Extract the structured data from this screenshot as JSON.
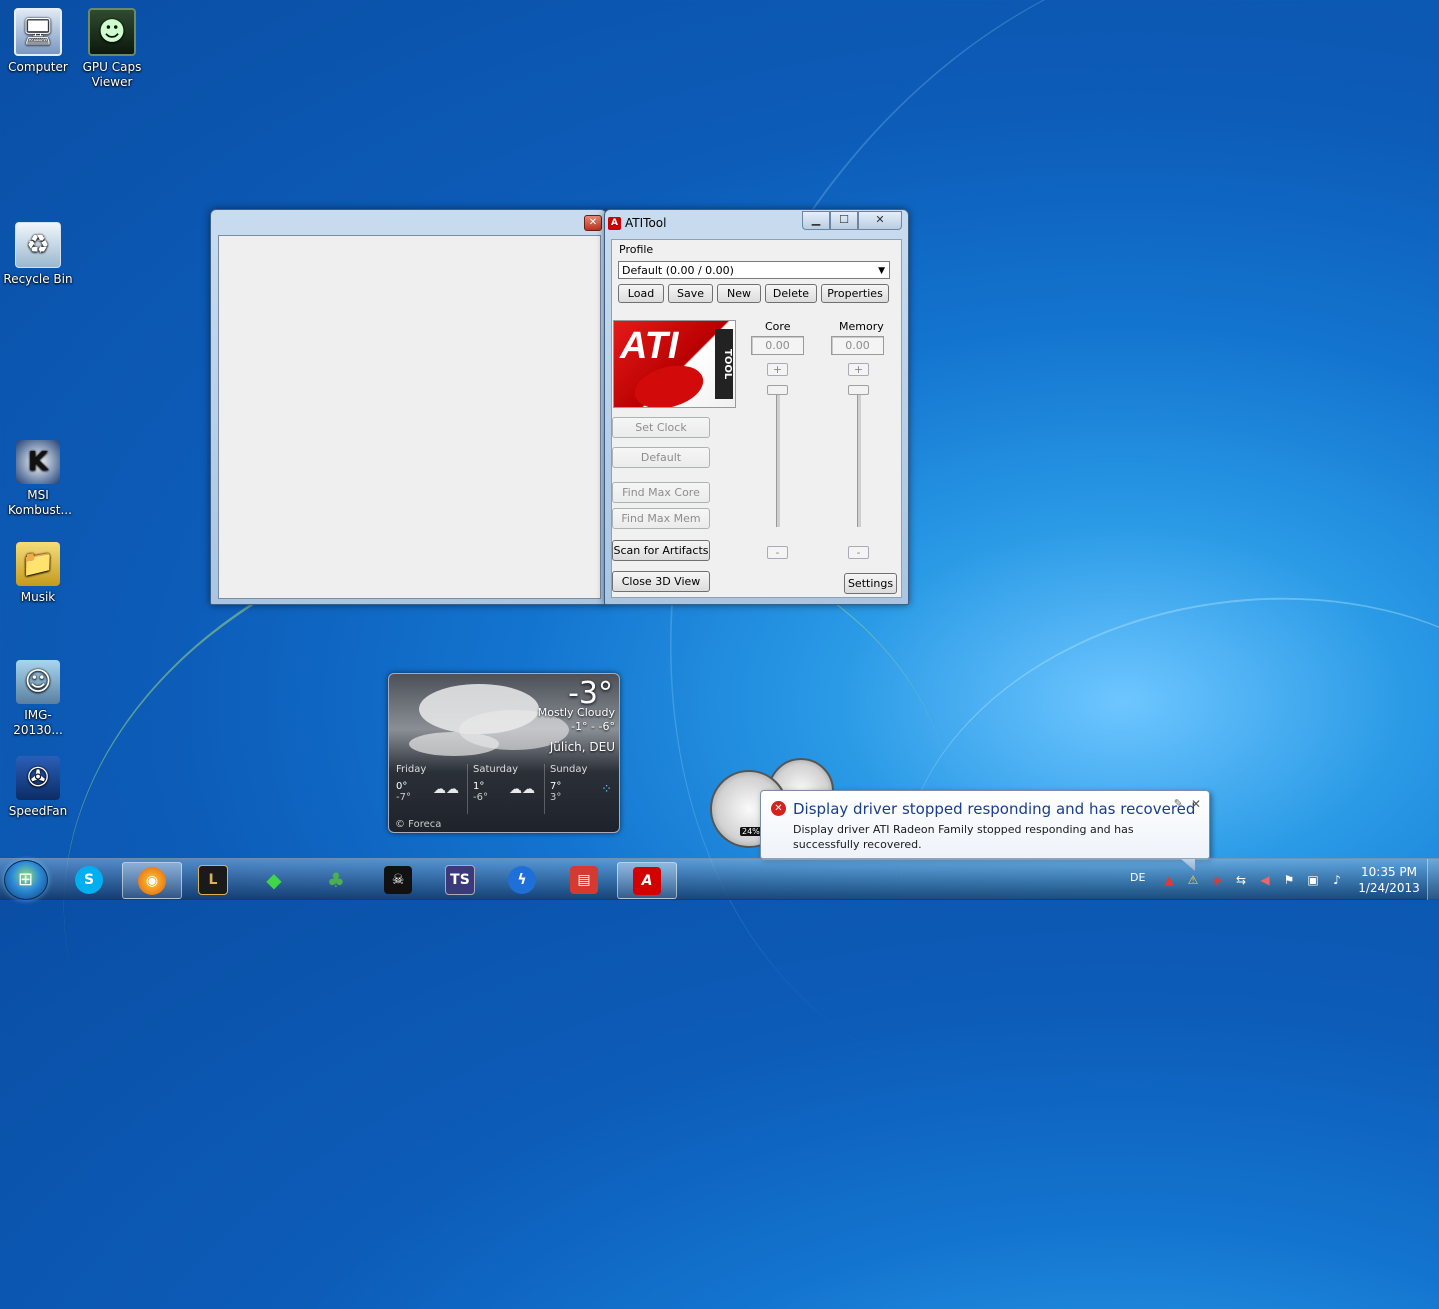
{
  "desktop_icons": [
    {
      "label": "Computer",
      "icon": "computer-icon"
    },
    {
      "label": "GPU Caps Viewer",
      "icon": "gpu-caps-icon"
    },
    {
      "label": "Recycle Bin",
      "icon": "recycle-bin-icon"
    },
    {
      "label": "MSI Kombust...",
      "icon": "msi-kombustor-icon"
    },
    {
      "label": "Musik",
      "icon": "folder-icon"
    },
    {
      "label": "IMG-20130...",
      "icon": "photo-icon"
    },
    {
      "label": "SpeedFan",
      "icon": "speedfan-icon"
    }
  ],
  "atitool": {
    "title": "ATITool",
    "profile_label": "Profile",
    "profile_value": "Default (0.00 / 0.00)",
    "buttons": {
      "load": "Load",
      "save": "Save",
      "new": "New",
      "delete": "Delete",
      "properties": "Properties",
      "set_clock": "Set Clock",
      "default": "Default",
      "find_max_core": "Find Max Core",
      "find_max_mem": "Find Max Mem",
      "scan_artifacts": "Scan for Artifacts",
      "close_3d": "Close 3D View",
      "settings": "Settings"
    },
    "core_label": "Core",
    "core_value": "0.00",
    "memory_label": "Memory",
    "memory_value": "0.00",
    "logo_text": "ATI",
    "logo_sub": "TOOL",
    "plus": "+",
    "minus": "-"
  },
  "weather": {
    "temp": "-3°",
    "condition": "Mostly Cloudy",
    "range": "-1° - -6°",
    "city": "Jülich, DEU",
    "forecast": [
      {
        "day": "Friday",
        "high": "0°",
        "low": "-7°"
      },
      {
        "day": "Saturday",
        "high": "1°",
        "low": "-6°"
      },
      {
        "day": "Sunday",
        "high": "7°",
        "low": "3°"
      }
    ],
    "source": "© Foreca"
  },
  "cpu_gadget": {
    "percent": "24%"
  },
  "notification": {
    "title": "Display driver stopped responding and has recovered",
    "message": "Display driver ATI Radeon Family stopped responding and has successfully recovered."
  },
  "taskbar": {
    "language": "DE",
    "time": "10:35 PM",
    "date": "1/24/2013",
    "apps": [
      "skype-icon",
      "firefox-icon",
      "league-of-legends-icon",
      "sims-icon",
      "tree-app-icon",
      "skull-app-icon",
      "teamspeak-icon",
      "lightning-app-icon",
      "media-app-icon",
      "atitool-icon"
    ]
  },
  "colors": {
    "accent": "#1374cf",
    "error": "#d0231a",
    "balloon_title": "#1a3e8c"
  }
}
